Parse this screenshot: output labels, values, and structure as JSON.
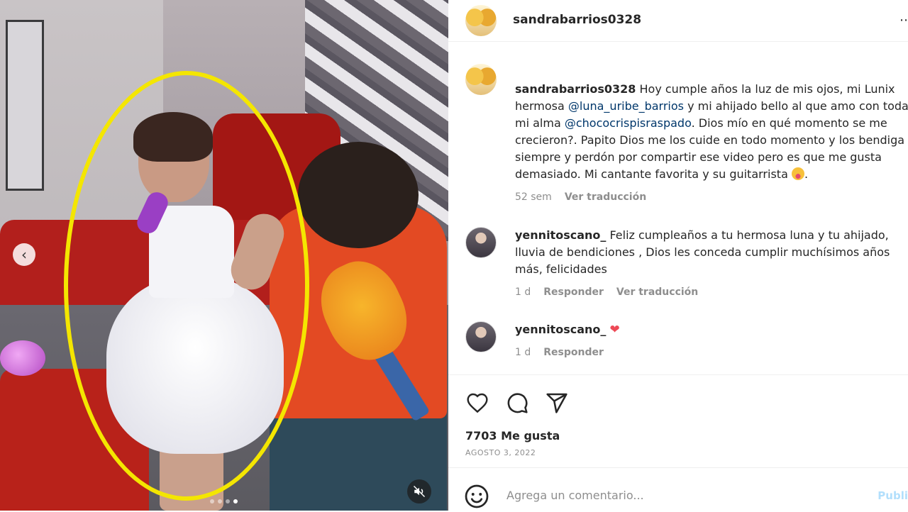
{
  "post": {
    "username": "sandrabarrios0328",
    "likes": "7703 Me gusta",
    "date": "AGOSTO 3, 2022",
    "comment_placeholder": "Agrega un comentario...",
    "publish_label": "Publi"
  },
  "caption": {
    "username": "sandrabarrios0328",
    "text_1": " Hoy cumple años la luz de mis ojos, mi Lunix hermosa ",
    "mention_1": "@luna_uribe_barrios",
    "text_2": " y mi ahijado bello al que amo con toda mi alma ",
    "mention_2": "@chococrispisraspado",
    "text_3": ". Dios mío en qué momento se me crecieron?. Papito Dios me los cuide en todo momento y los bendiga siempre y perdón por compartir ese video pero es que me gusta demasiado. Mi cantante favorita y su guitarrista ",
    "text_4": ".",
    "time": "52 sem",
    "translate": "Ver traducción"
  },
  "comments": [
    {
      "username": "yennitoscano_",
      "text": " Feliz cumpleaños a tu hermosa luna y tu ahijado, lluvia de bendiciones , Dios les conceda cumplir muchísimos años más, felicidades",
      "time": "1 d",
      "reply": "Responder",
      "translate": "Ver traducción"
    },
    {
      "username": "yennitoscano_",
      "text": "❤",
      "time": "1 d",
      "reply": "Responder"
    }
  ],
  "icons": {
    "like": "heart-icon",
    "comment": "comment-icon",
    "share": "share-icon",
    "emoji": "emoji-icon",
    "prev": "chevron-left-icon",
    "mute": "muted-speaker-icon"
  },
  "colors": {
    "highlight": "#f4e600",
    "mention": "#00376b",
    "meta": "#8e8e8e",
    "heart": "#ed4956"
  },
  "carousel": {
    "total_slides": 4,
    "active_slide": 4
  }
}
